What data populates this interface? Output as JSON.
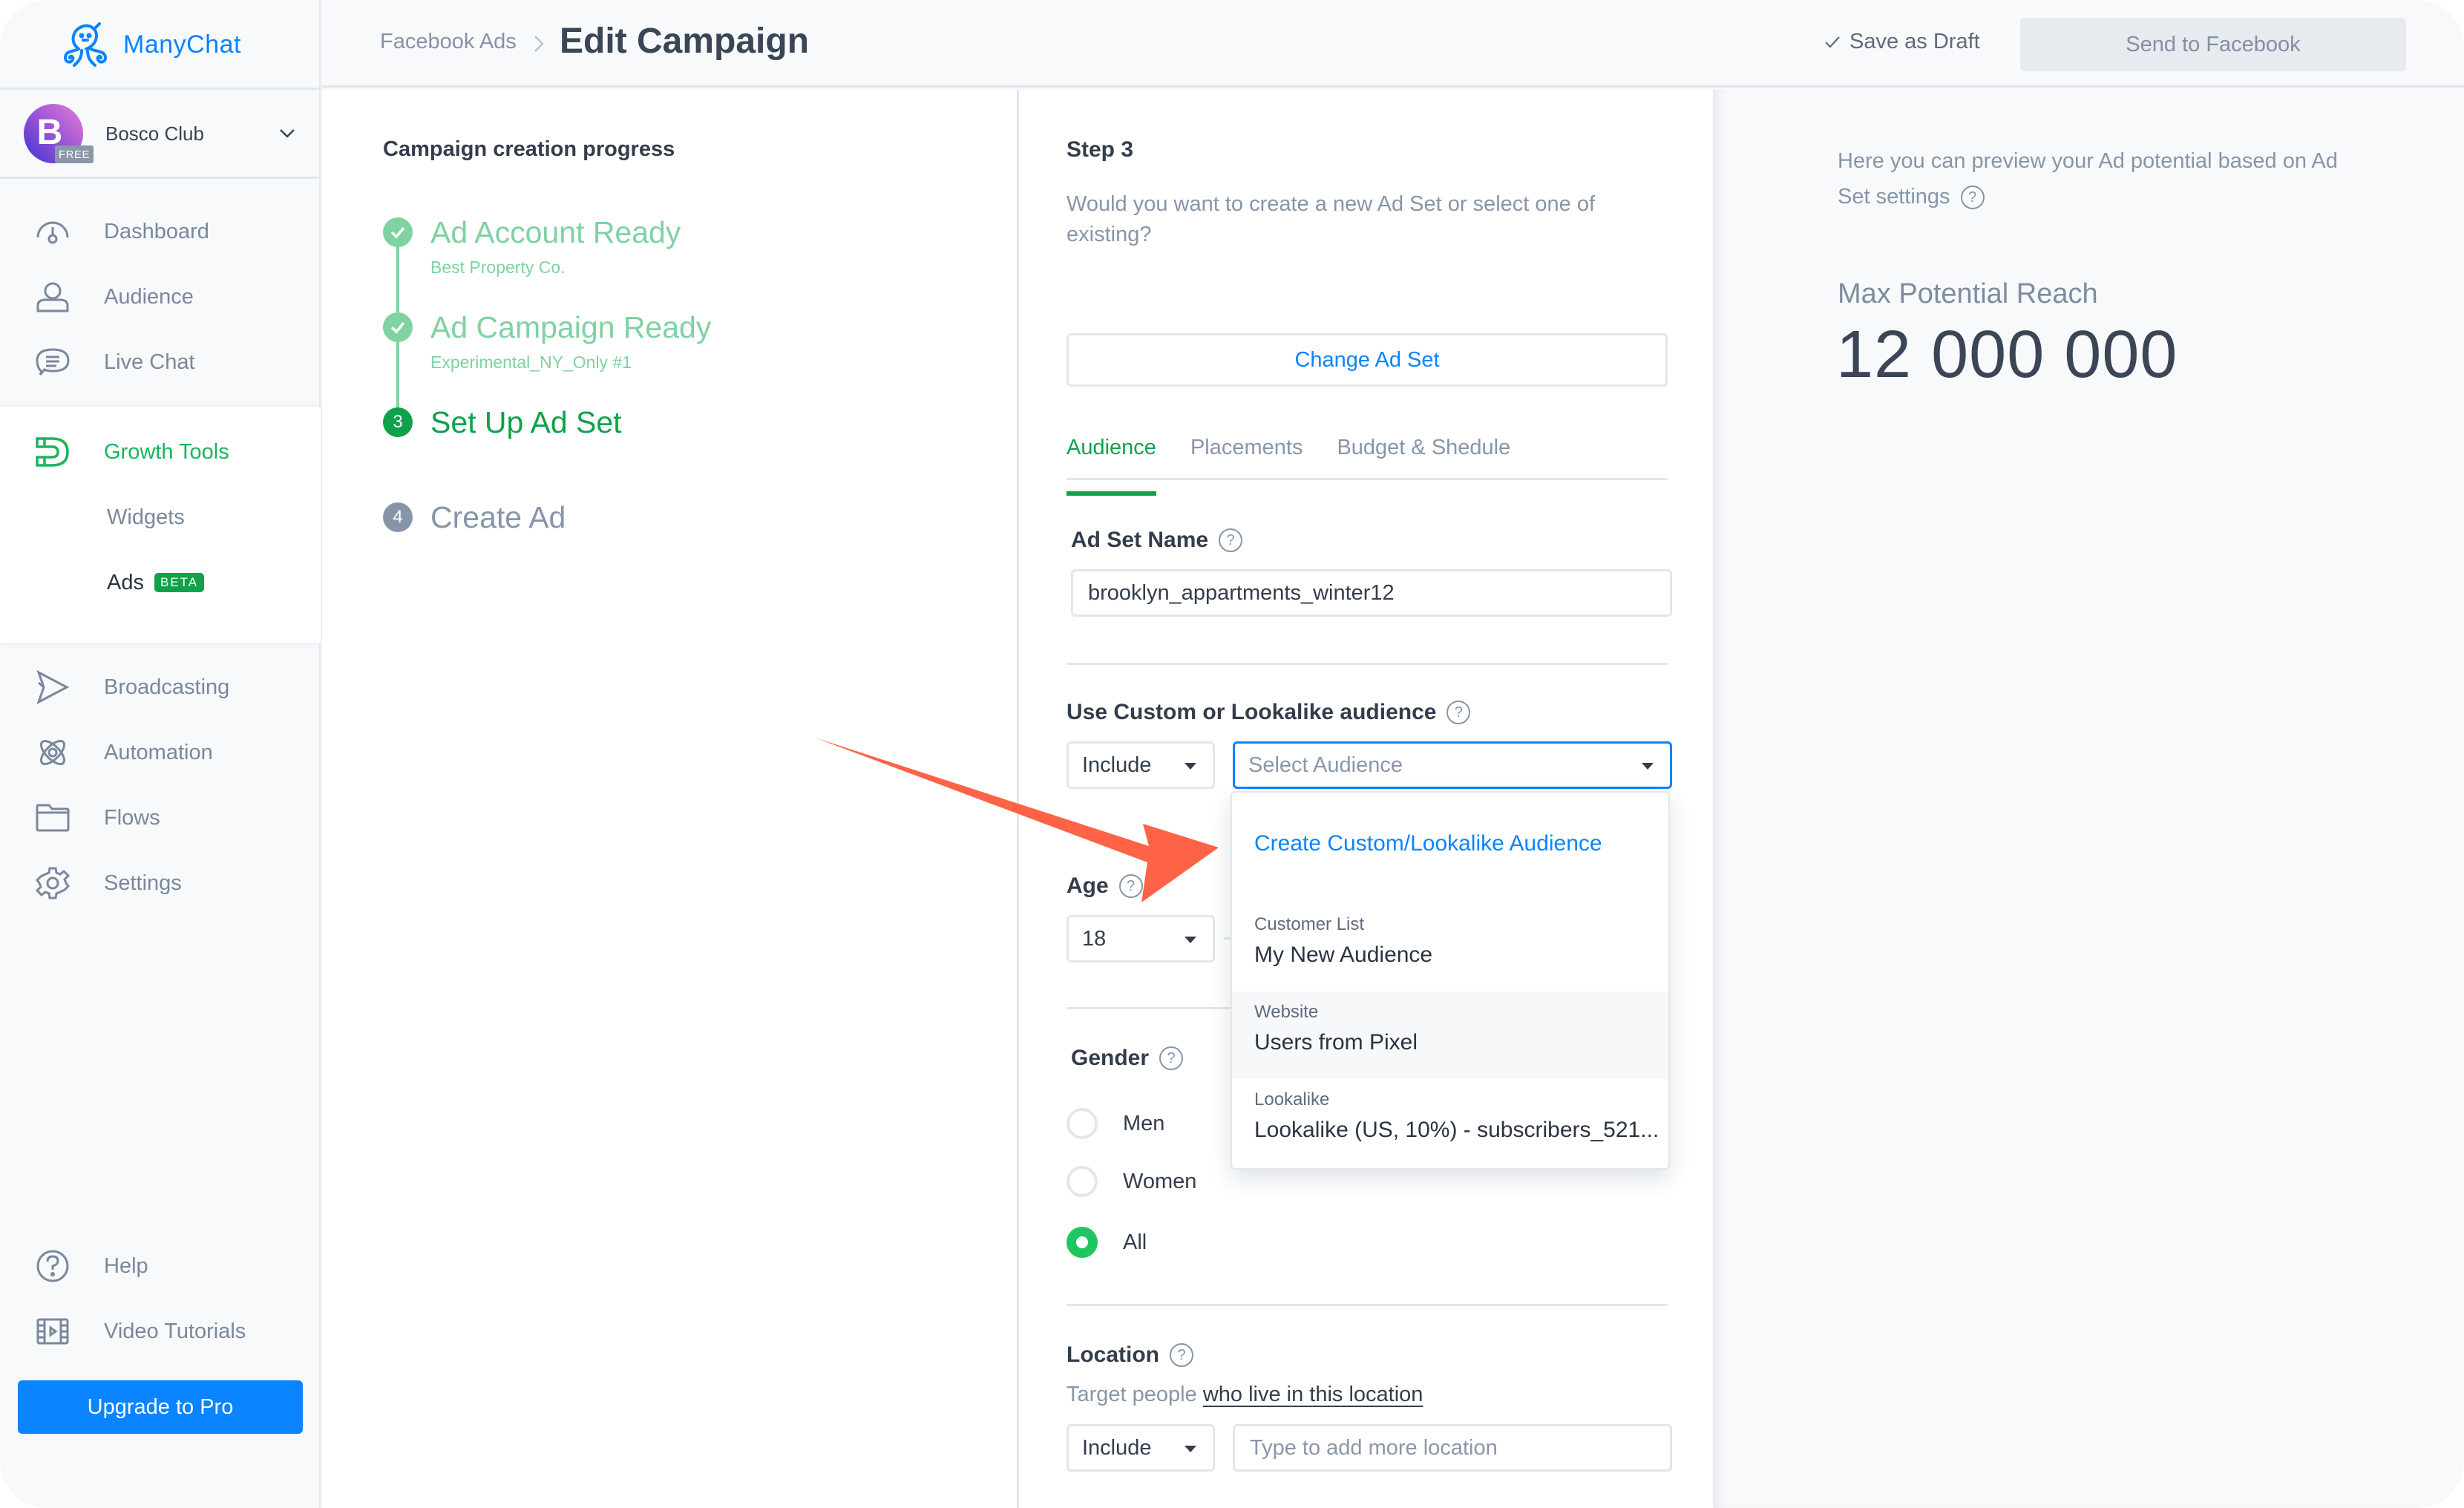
{
  "app": {
    "brand": "ManyChat",
    "brand_color": "#0a84ff",
    "accent_green": "#0fa24a"
  },
  "sidebar": {
    "account": {
      "initial": "B",
      "badge": "FREE",
      "name": "Bosco Club"
    },
    "items": [
      {
        "label": "Dashboard",
        "icon": "dashboard-gauge-icon"
      },
      {
        "label": "Audience",
        "icon": "user-icon"
      },
      {
        "label": "Live Chat",
        "icon": "chat-bubble-icon"
      },
      {
        "label": "Growth Tools",
        "icon": "magnet-icon",
        "active": true
      },
      {
        "label": "Widgets"
      },
      {
        "label": "Ads",
        "badge": "BETA",
        "selected": true
      },
      {
        "label": "Broadcasting",
        "icon": "send-icon"
      },
      {
        "label": "Automation",
        "icon": "atom-icon"
      },
      {
        "label": "Flows",
        "icon": "folder-icon"
      },
      {
        "label": "Settings",
        "icon": "gear-icon"
      },
      {
        "label": "Help",
        "icon": "help-circle-icon"
      },
      {
        "label": "Video Tutorials",
        "icon": "film-icon"
      }
    ],
    "upgrade_label": "Upgrade to Pro"
  },
  "header": {
    "breadcrumb": "Facebook Ads",
    "title": "Edit Campaign",
    "save_draft": "Save as Draft",
    "send": "Send to Facebook"
  },
  "progress": {
    "title": "Campaign creation progress",
    "steps": [
      {
        "number": "1",
        "label": "Ad Account Ready",
        "sub": "Best Property Co.",
        "state": "done"
      },
      {
        "number": "2",
        "label": "Ad Campaign Ready",
        "sub": "Experimental_NY_Only #1",
        "state": "done"
      },
      {
        "number": "3",
        "label": "Set Up Ad Set",
        "state": "current"
      },
      {
        "number": "4",
        "label": "Create Ad",
        "state": "todo"
      }
    ]
  },
  "form": {
    "step": "Step 3",
    "description": "Would you want to create a new Ad Set or select one of existing?",
    "change_button": "Change Ad Set",
    "tabs": [
      {
        "label": "Audience",
        "active": true
      },
      {
        "label": "Placements"
      },
      {
        "label": "Budget & Shedule"
      }
    ],
    "ad_set_name": {
      "label": "Ad Set Name",
      "value": "brooklyn_appartments_winter12"
    },
    "custom_audience": {
      "label": "Use Custom or Lookalike audience",
      "include": "Include",
      "placeholder": "Select Audience"
    },
    "age": {
      "label": "Age",
      "min": "18"
    },
    "gender": {
      "label": "Gender",
      "options": [
        "Men",
        "Women",
        "All"
      ],
      "selected": "All"
    },
    "location": {
      "label": "Location",
      "text_prefix": "Target people",
      "text_link": "who live in this location",
      "include": "Include",
      "placeholder": "Type to add more location"
    }
  },
  "dropdown": {
    "create_label": "Create Custom/Lookalike Audience",
    "items": [
      {
        "category": "Customer List",
        "value": "My New Audience"
      },
      {
        "category": "Website",
        "value": "Users from Pixel",
        "hover": true
      },
      {
        "category": "Lookalike",
        "value": "Lookalike (US, 10%) - subscribers_521..."
      }
    ]
  },
  "preview": {
    "description": "Here you can preview your Ad potential based on Ad Set settings",
    "reach_label": "Max Potential Reach",
    "reach_value": "12 000 000"
  },
  "annotation": {
    "arrow_color": "#ff6347"
  }
}
